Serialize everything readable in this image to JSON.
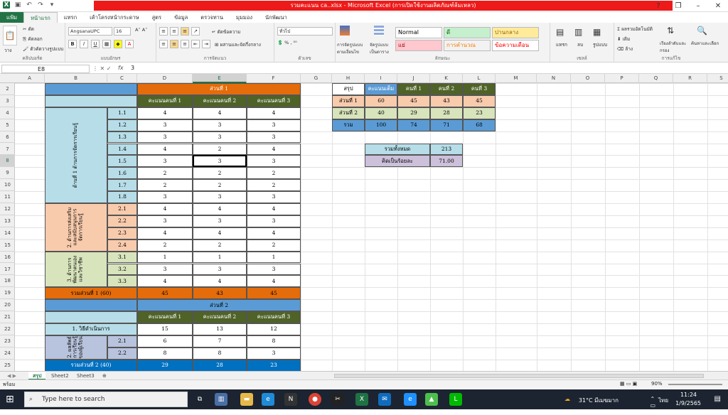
{
  "window": {
    "title": "รวมคะแนน ca..xlsx - Microsoft Excel (การเปิดใช้งานผลิตภัณฑ์ล้มเหลว)"
  },
  "ribbon_tabs": [
    "แฟ้ม",
    "หน้าแรก",
    "แทรก",
    "เค้าโครงหน้ากระดาษ",
    "สูตร",
    "ข้อมูล",
    "ตรวจทาน",
    "มุมมอง",
    "นักพัฒนา"
  ],
  "ribbon": {
    "paste": "วาง",
    "cut": "ตัด",
    "copy": "คัดลอก",
    "format_painter": "ตัวคัดวางรูปแบบ",
    "clipboard": "คลิปบอร์ด",
    "font_name": "AngsanaUPC",
    "font_size": "16",
    "font_group": "แบบอักษร",
    "bold": "B",
    "italic": "I",
    "underline": "U",
    "wrap": "ตัดข้อความ",
    "merge": "ผสานและจัดกึ่งกลาง",
    "align_group": "การจัดแนว",
    "number_format": "ทั่วไป",
    "number_group": "ตัวเลข",
    "cond_format": "การจัดรูปแบบตามเงื่อนไข",
    "format_table": "จัดรูปแบบเป็นตาราง",
    "styles": [
      {
        "label": "Normal",
        "bg": "#ffffff",
        "fg": "#000000"
      },
      {
        "label": "ดี",
        "bg": "#c6efce",
        "fg": "#006100"
      },
      {
        "label": "ปานกลาง",
        "bg": "#ffeb9c",
        "fg": "#9c6500"
      },
      {
        "label": "แย่",
        "bg": "#ffc7ce",
        "fg": "#9c0006"
      },
      {
        "label": "การคำนวณ",
        "bg": "#f2f2f2",
        "fg": "#fa7d00"
      },
      {
        "label": "ข้อความเตือน",
        "bg": "#ffffff",
        "fg": "#ff0000"
      }
    ],
    "styles_group": "ลักษณะ",
    "insert": "แทรก",
    "delete": "ลบ",
    "format": "รูปแบบ",
    "cells_group": "เซลล์",
    "autosum": "ผลรวมอัตโนมัติ",
    "fill": "เติม",
    "clear": "ล้าง",
    "sort": "เรียงลำดับและกรอง",
    "find": "ค้นหาและเลือก",
    "edit_group": "การแก้ไข"
  },
  "formula": {
    "cell": "E8",
    "fx": "fx",
    "value": "3"
  },
  "columns": [
    "A",
    "B",
    "C",
    "D",
    "E",
    "F",
    "G",
    "H",
    "I",
    "J",
    "K",
    "L",
    "M",
    "N",
    "O",
    "P",
    "Q",
    "R",
    "S"
  ],
  "rows": [
    "2",
    "3",
    "4",
    "5",
    "6",
    "7",
    "8",
    "9",
    "10",
    "11",
    "12",
    "13",
    "14",
    "15",
    "16",
    "17",
    "18",
    "19",
    "20",
    "21",
    "22",
    "23",
    "24",
    "25"
  ],
  "part1": {
    "title": "ส่วนที่ 1",
    "headers": [
      "คะแนนคนที่ 1",
      "คะแนนคนที่ 2",
      "คะแนนคนที่ 3"
    ],
    "section1": "ด้านที่ 1 ด้านการจัดการเรียนรู้",
    "section2": "2. ด้านการส่งเสริมและสนับสนุนการจัดการเรียนรู้",
    "section3": "3. ด้านการพัฒนาตนเองและวิชาชีพ",
    "items": [
      [
        "1.1",
        "4",
        "4",
        "4"
      ],
      [
        "1.2",
        "3",
        "3",
        "3"
      ],
      [
        "1.3",
        "3",
        "3",
        "3"
      ],
      [
        "1.4",
        "4",
        "2",
        "4"
      ],
      [
        "1.5",
        "3",
        "3",
        "3"
      ],
      [
        "1.6",
        "2",
        "2",
        "2"
      ],
      [
        "1.7",
        "2",
        "2",
        "2"
      ],
      [
        "1.8",
        "3",
        "3",
        "3"
      ],
      [
        "2.1",
        "4",
        "4",
        "4"
      ],
      [
        "2.2",
        "3",
        "3",
        "3"
      ],
      [
        "2.3",
        "4",
        "4",
        "4"
      ],
      [
        "2.4",
        "2",
        "2",
        "2"
      ],
      [
        "3.1",
        "1",
        "1",
        "1"
      ],
      [
        "3.2",
        "3",
        "3",
        "3"
      ],
      [
        "3.3",
        "4",
        "4",
        "4"
      ]
    ],
    "total_label": "รวมส่วนที่ 1 (60)",
    "totals": [
      "45",
      "43",
      "45"
    ]
  },
  "part2": {
    "title": "ส่วนที่ 2",
    "headers": [
      "คะแนนคนที่ 1",
      "คะแนนคนที่ 2",
      "คะแนนคนที่ 3"
    ],
    "method_label": "1. วิธีดำเนินการ",
    "method": [
      "15",
      "13",
      "12"
    ],
    "section2": "2. ผลลัพธ์การเรียนรู้ของผู้เรียน",
    "items": [
      [
        "2.1",
        "6",
        "7",
        "8"
      ],
      [
        "2.2",
        "8",
        "8",
        "3"
      ]
    ],
    "total_label": "รวมส่วนที่ 2 (40)",
    "totals": [
      "29",
      "28",
      "23"
    ]
  },
  "summary": {
    "headers": [
      "สรุป",
      "คะแนนเต็ม",
      "คนที่ 1",
      "คนที่ 2",
      "คนที่ 3"
    ],
    "rows": [
      [
        "ส่วนที่ 1",
        "60",
        "45",
        "43",
        "45"
      ],
      [
        "ส่วนที่ 2",
        "40",
        "29",
        "28",
        "23"
      ],
      [
        "รวม",
        "100",
        "74",
        "71",
        "68"
      ]
    ],
    "total_label": "รวมทั้งหมด",
    "total_value": "213",
    "pct_label": "คิดเป็นร้อยละ",
    "pct_value": "71.00"
  },
  "sheets": [
    "สรุป",
    "Sheet2",
    "Sheet3"
  ],
  "status": {
    "mode": "พร้อม",
    "zoom": "90%"
  },
  "taskbar": {
    "search": "Type here to search",
    "weather": "31°C มีเมฆมาก",
    "lang": "ไทย",
    "time": "11:24",
    "date": "1/9/2565"
  }
}
